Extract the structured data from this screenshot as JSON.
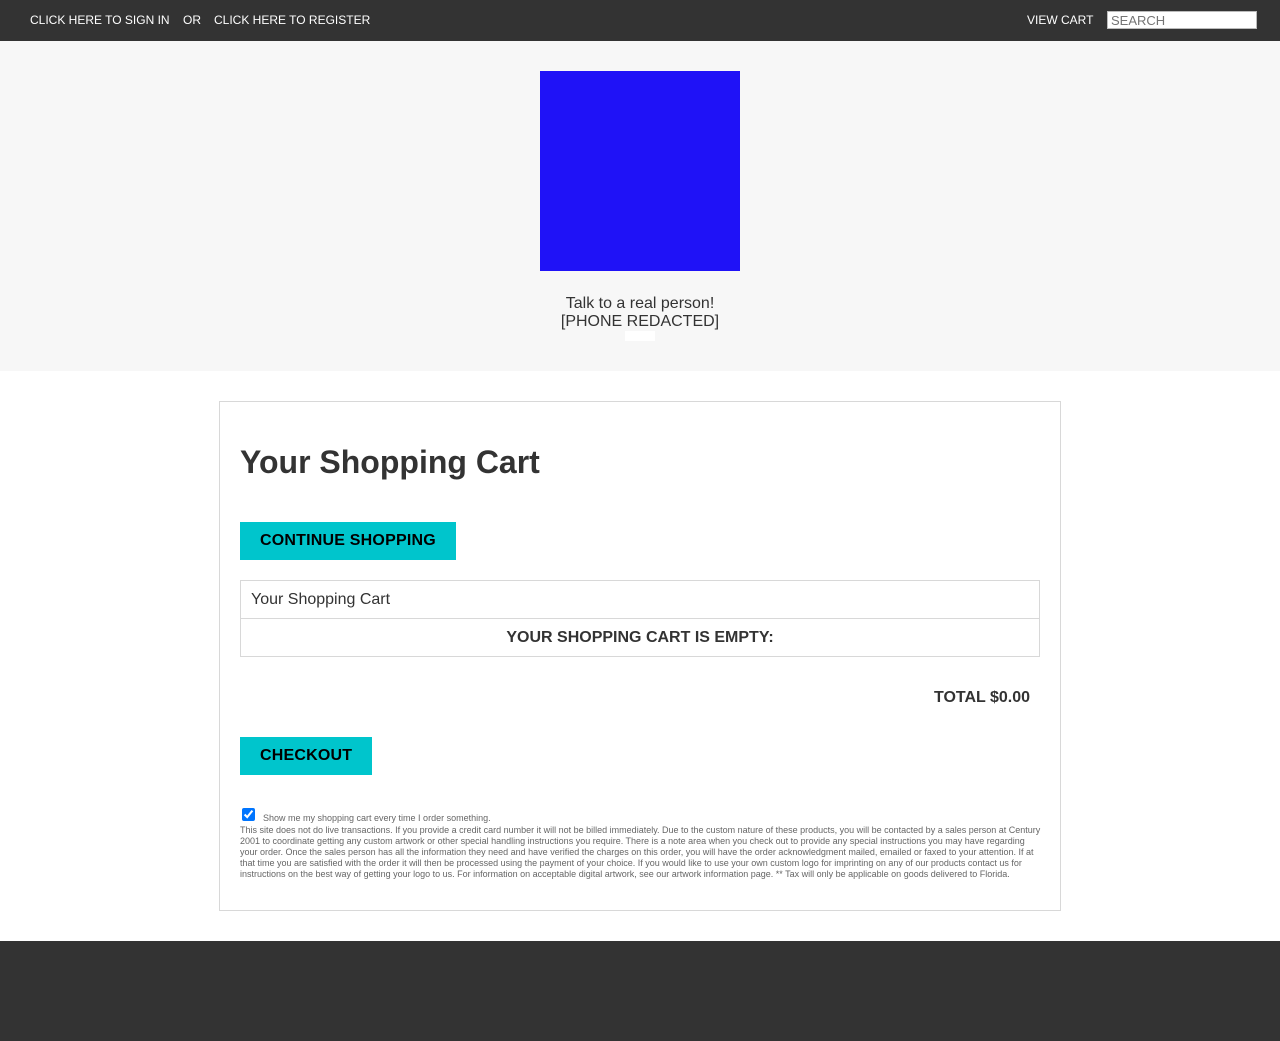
{
  "topbar": {
    "sign_in": "CLICK HERE TO SIGN IN",
    "or": "OR",
    "register": "CLICK HERE TO REGISTER",
    "view_cart": "VIEW CART",
    "search_placeholder": "SEARCH",
    "background_color": "#333333"
  },
  "header": {
    "logo_color": "#1f12f7",
    "talk_line": "Talk to a real person!",
    "phone": "[PHONE REDACTED]"
  },
  "cart": {
    "title": "Your Shopping Cart",
    "continue_label": "CONTINUE SHOPPING",
    "table_header": "Your Shopping Cart",
    "empty_message": "YOUR SHOPPING CART IS EMPTY:",
    "total": "TOTAL $0.00",
    "checkout_label": "CHECKOUT",
    "show_cart_checked": true,
    "show_cart_label": "Show me my shopping cart every time I order something.",
    "disclaimer": "This site does not do live transactions. If you provide a credit card number it will not be billed immediately. Due to the custom nature of these products, you will be contacted by a sales person at Century 2001 to coordinate getting any custom artwork or other special handling instructions you require. There is a note area when you check out to provide any special instructions you may have regarding your order. Once the sales person has all the information they need and have verified the charges on this order, you will have the order acknowledgment mailed, emailed or faxed to your attention. If at that time you are satisfied with the order it will then be processed using the payment of your choice. If you would like to use your own custom logo for imprinting on any of our products contact us for instructions on the best way of getting your logo to us. For information on acceptable digital artwork, see our artwork information page. ** Tax will only be applicable on goods delivered to Florida.",
    "button_color": "#00c5cc"
  }
}
